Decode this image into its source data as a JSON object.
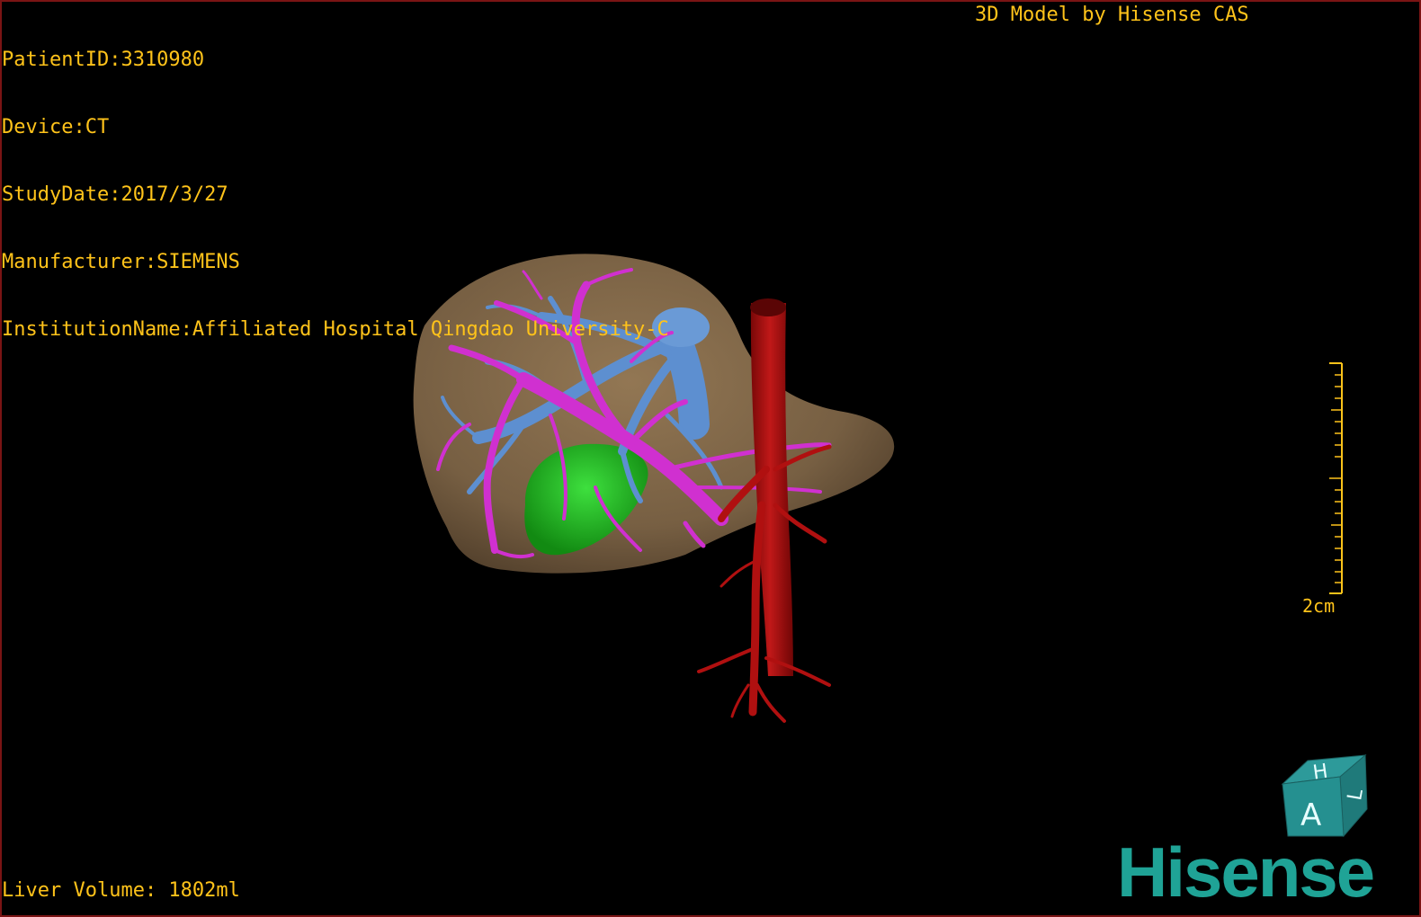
{
  "patient_info": {
    "patient_id": "PatientID:3310980",
    "device": "Device:CT",
    "study_date": "StudyDate:2017/3/27",
    "manufacturer": "Manufacturer:SIEMENS",
    "institution": "InstitutionName:Affiliated Hospital Qingdao University-C"
  },
  "credit": "3D Model by Hisense CAS",
  "liver_volume": "Liver Volume: 1802ml",
  "scale": {
    "label": "2cm"
  },
  "orientation_cube": {
    "face_front": "A",
    "face_top": "H",
    "face_side": "L"
  },
  "brand": "Hisense",
  "colors": {
    "overlay_text": "#ffc31a",
    "liver": "#8a6f4e",
    "portal_vein": "#d030d0",
    "hepatic_vein": "#5d8fd0",
    "artery": "#b01010",
    "gallbladder": "#1fae1f",
    "brand": "#1fa396"
  }
}
